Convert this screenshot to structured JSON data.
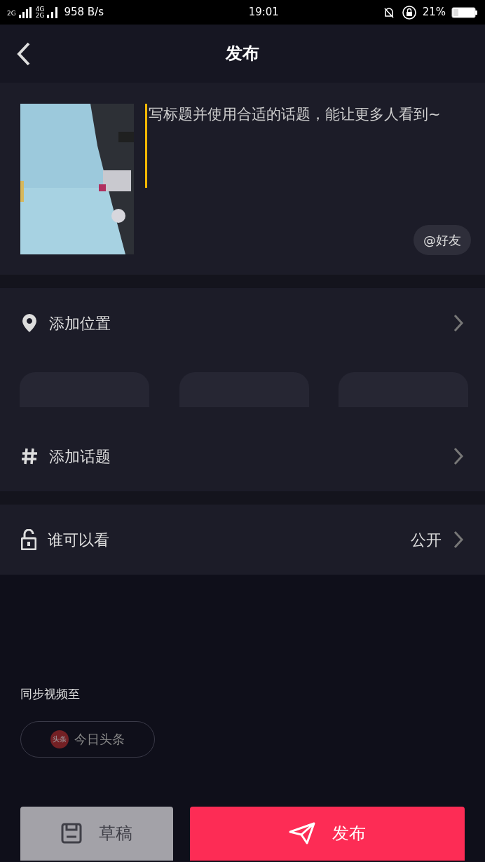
{
  "status_bar": {
    "sim1": "2G",
    "sim2_top": "4G",
    "sim2_bottom": "2G",
    "speed": "958 B/s",
    "time": "19:01",
    "battery": "21%"
  },
  "header": {
    "title": "发布"
  },
  "post": {
    "placeholder": "写标题并使用合适的话题，能让更多人看到~",
    "mention_button": "@好友"
  },
  "location": {
    "label": "添加位置"
  },
  "suggestion_chips": [
    {
      "kind": "placeholder"
    },
    {
      "kind": "placeholder"
    },
    {
      "kind": "placeholder"
    }
  ],
  "topic": {
    "label": "添加话题"
  },
  "visibility": {
    "label": "谁可以看",
    "value": "公开"
  },
  "sync": {
    "label": "同步视频至",
    "targets": [
      {
        "badge": "头条",
        "label": "今日头条",
        "selected": false
      }
    ]
  },
  "buttons": {
    "draft": "草稿",
    "publish": "发布"
  }
}
